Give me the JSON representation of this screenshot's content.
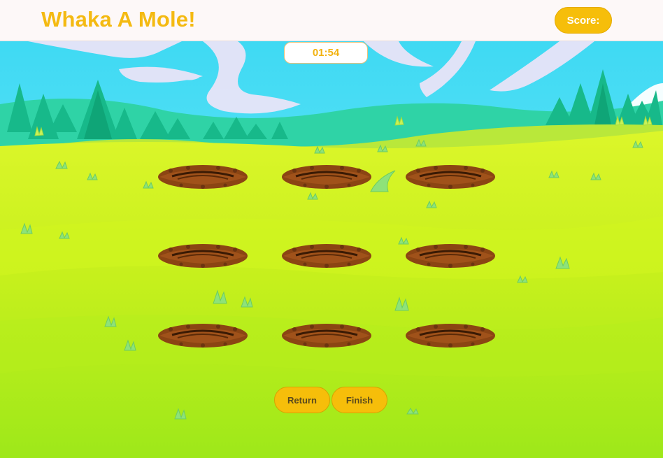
{
  "header": {
    "title": "Whaka A Mole!",
    "score_label": "Score:"
  },
  "game": {
    "timer": "01:54",
    "holes": [
      {
        "row": 1,
        "col": 1
      },
      {
        "row": 1,
        "col": 2
      },
      {
        "row": 1,
        "col": 3
      },
      {
        "row": 2,
        "col": 1
      },
      {
        "row": 2,
        "col": 2
      },
      {
        "row": 2,
        "col": 3
      },
      {
        "row": 3,
        "col": 1
      },
      {
        "row": 3,
        "col": 2
      },
      {
        "row": 3,
        "col": 3
      }
    ]
  },
  "controls": {
    "return_label": "Return",
    "finish_label": "Finish"
  },
  "colors": {
    "accent": "#f6be0a",
    "sky": "#4fe0f5",
    "grass": "#c2f21e",
    "dirt": "#8b4513"
  }
}
